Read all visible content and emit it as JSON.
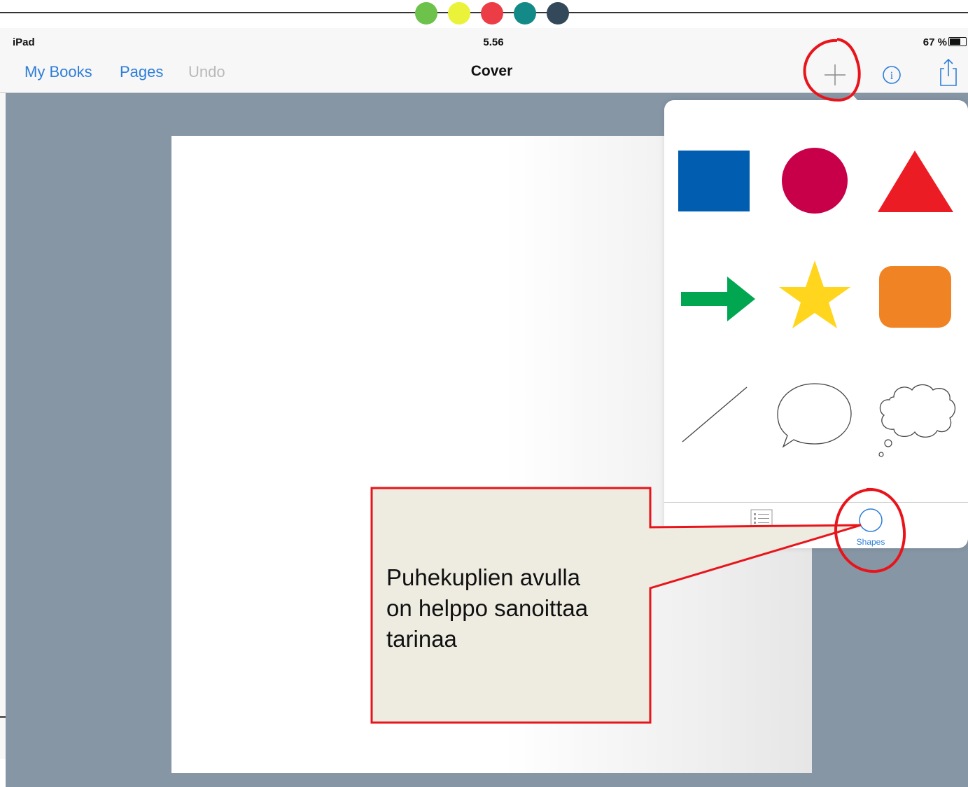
{
  "header_dots": {
    "colors": [
      "#6cc24a",
      "#eaf33a",
      "#ec3d47",
      "#138a87",
      "#33495a"
    ]
  },
  "statusbar": {
    "device": "iPad",
    "time": "5.56",
    "battery": "67 %",
    "battery_icon": "battery-icon"
  },
  "navbar": {
    "my_books": "My Books",
    "pages": "Pages",
    "undo": "Undo",
    "title": "Cover",
    "icons": [
      "plus-icon",
      "info-icon",
      "share-icon"
    ],
    "link_color": "#2d7ed8",
    "disabled_color": "#b9b9b9"
  },
  "canvas": {
    "background": "#8796a5",
    "page_color": "#ffffff"
  },
  "shapes_popover": {
    "items": [
      {
        "name": "square",
        "color": "#005db0"
      },
      {
        "name": "circle",
        "color": "#c8004a"
      },
      {
        "name": "triangle",
        "color": "#ec1c24"
      },
      {
        "name": "arrow",
        "color": "#00a650"
      },
      {
        "name": "star",
        "color": "#ffd51e"
      },
      {
        "name": "rounded-square",
        "color": "#f08323"
      },
      {
        "name": "line",
        "color": "#333333"
      },
      {
        "name": "speech-bubble",
        "color": "#333333"
      },
      {
        "name": "thought-bubble",
        "color": "#333333"
      }
    ],
    "tabs": [
      {
        "label": "",
        "icon": "list-icon"
      },
      {
        "label": "Shapes",
        "icon": "circle-icon",
        "selected": true
      }
    ]
  },
  "callout": {
    "text_lines": [
      "Puhekuplien avulla",
      "on helppo sanoittaa",
      "tarinaa"
    ],
    "fill": "#eeebe1",
    "border": "#e8141b"
  }
}
